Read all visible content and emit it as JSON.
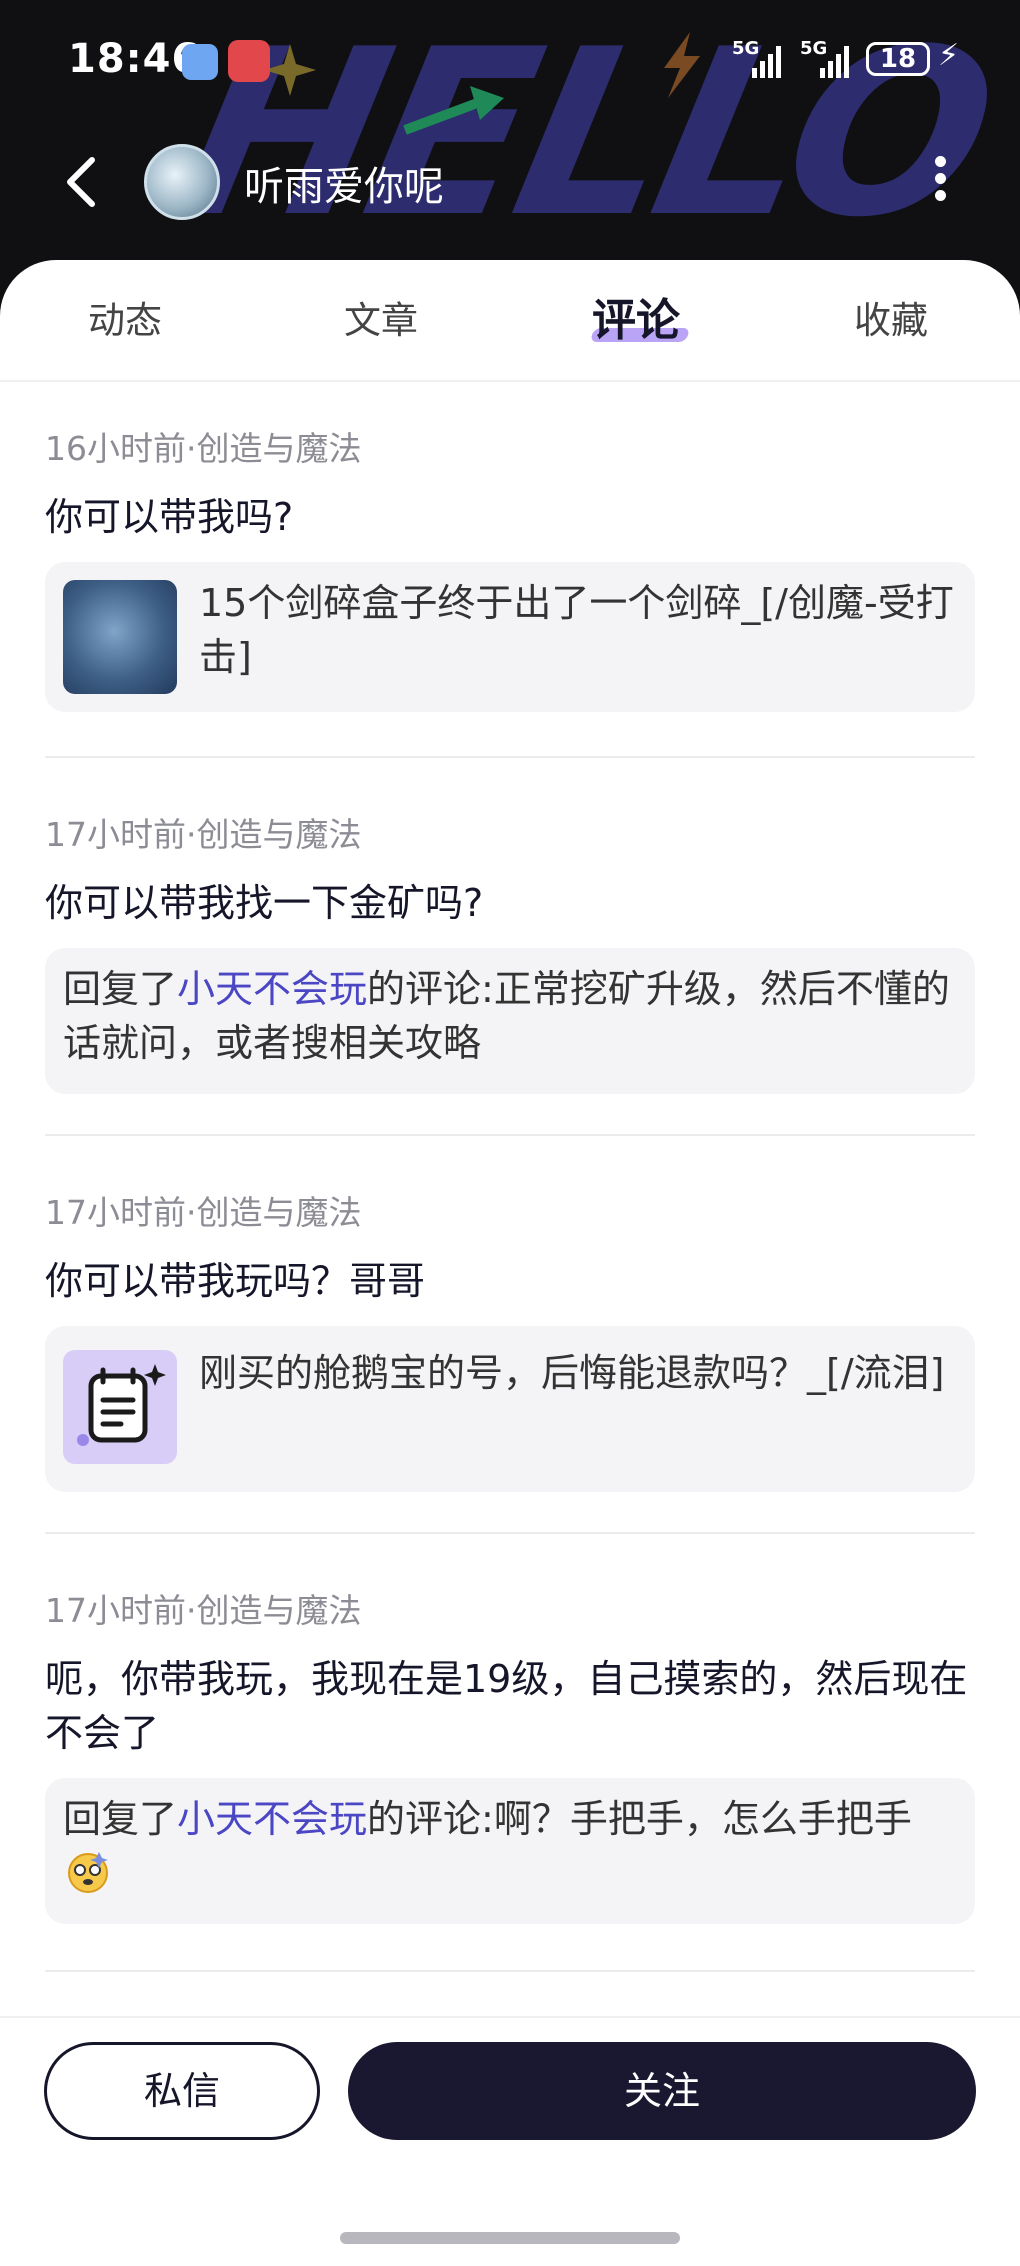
{
  "status_bar": {
    "time": "18:46",
    "network_1": "5G",
    "network_2": "5G",
    "battery": "18"
  },
  "header": {
    "username": "听雨爱你呢",
    "background_art_text": "HELLO"
  },
  "tabs": [
    {
      "label": "动态",
      "active": false
    },
    {
      "label": "文章",
      "active": false
    },
    {
      "label": "评论",
      "active": true
    },
    {
      "label": "收藏",
      "active": false
    }
  ],
  "comments": [
    {
      "meta": "16小时前·创造与魔法",
      "text": "你可以带我吗?",
      "card_text": "15个剑碎盒子终于出了一个剑碎_[/创魔-受打击]"
    },
    {
      "meta": "17小时前·创造与魔法",
      "text": "你可以带我找一下金矿吗?",
      "reply_prefix": "回复了",
      "reply_user": "小天不会玩",
      "reply_rest": "的评论:正常挖矿升级，然后不懂的话就问，或者搜相关攻略"
    },
    {
      "meta": "17小时前·创造与魔法",
      "text": "你可以带我玩吗？哥哥",
      "card_text": "刚买的舱鹅宝的号，后悔能退款吗？_[/流泪]"
    },
    {
      "meta": "17小时前·创造与魔法",
      "text": "呃，你带我玩，我现在是19级，自己摸索的，然后现在不会了",
      "reply_prefix": "回复了",
      "reply_user": "小天不会玩",
      "reply_rest": "的评论:啊？手把手，怎么手把手"
    }
  ],
  "bottom": {
    "dm_label": "私信",
    "follow_label": "关注"
  },
  "colors": {
    "accent": "#4b46c4",
    "tab_underline": "#b9a4f5",
    "follow_button": "#1a1730",
    "header_bg": "#101012"
  }
}
